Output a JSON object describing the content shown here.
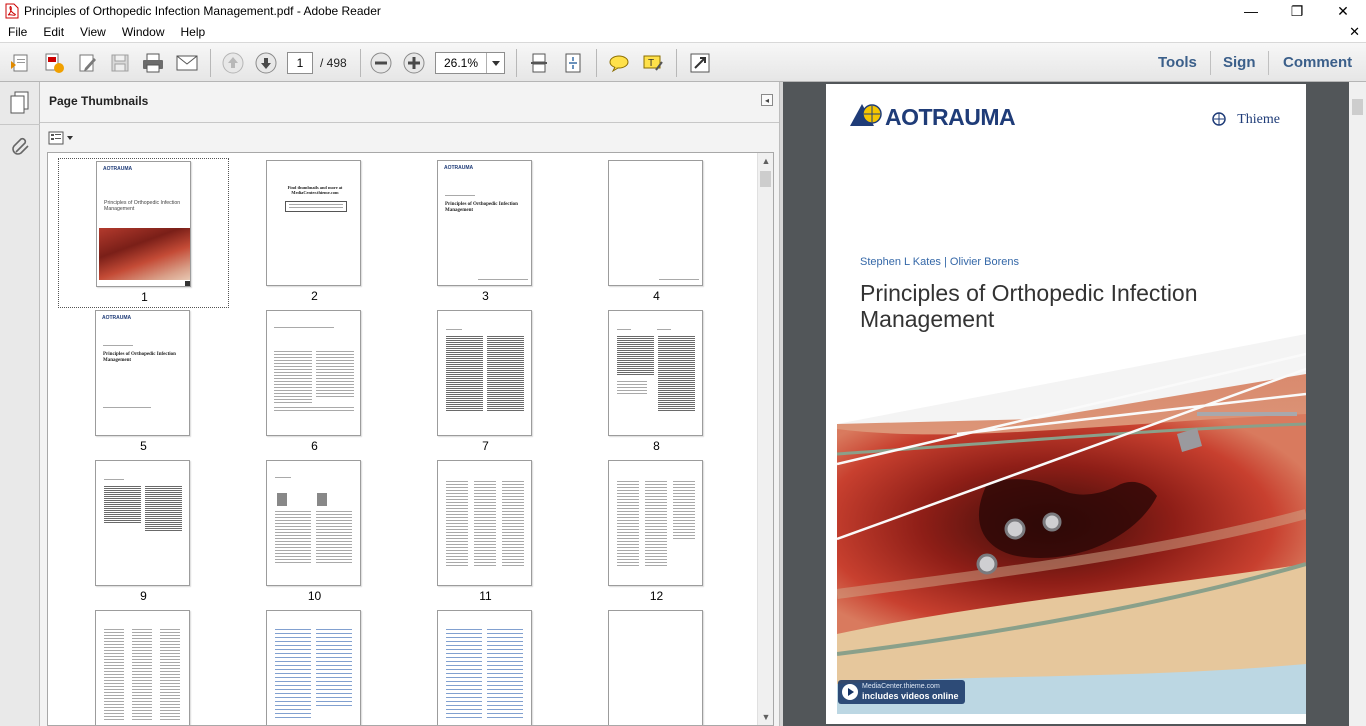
{
  "window": {
    "title": "Principles of Orthopedic Infection Management.pdf - Adobe Reader",
    "minimize": "—",
    "restore": "❐",
    "close": "✕"
  },
  "menu": {
    "items": [
      "File",
      "Edit",
      "View",
      "Window",
      "Help"
    ],
    "close_doc": "✕"
  },
  "toolbar": {
    "current_page": "1",
    "total_pages": "/ 498",
    "zoom": "26.1%",
    "links": {
      "tools": "Tools",
      "sign": "Sign",
      "comment": "Comment"
    }
  },
  "panel": {
    "title": "Page Thumbnails"
  },
  "thumbnails": {
    "p1": {
      "num": "1",
      "logo": "AOTRAUMA",
      "title": "Principles of Orthopedic Infection Management"
    },
    "p2": {
      "num": "2",
      "heading": "Find thumbnails and more at MediaCenter.thieme.com"
    },
    "p3": {
      "num": "3",
      "logo": "AOTRAUMA",
      "title": "Principles of Orthopedic Infection Management"
    },
    "p4": {
      "num": "4"
    },
    "p5": {
      "num": "5",
      "logo": "AOTRAUMA",
      "title": "Principles of Orthopedic Infection Management"
    },
    "p6": {
      "num": "6"
    },
    "p7": {
      "num": "7"
    },
    "p8": {
      "num": "8"
    },
    "p9": {
      "num": "9"
    },
    "p10": {
      "num": "10"
    },
    "p11": {
      "num": "11"
    },
    "p12": {
      "num": "12"
    }
  },
  "cover": {
    "logo": "AOTRAUMA",
    "publisher": "Thieme",
    "authors": "Stephen L Kates  |  Olivier Borens",
    "title": "Principles of Orthopedic Infection Management",
    "media_line1": "MediaCenter.thieme.com",
    "media_line2": "includes videos online"
  },
  "colors": {
    "ao_blue": "#1f3c78",
    "ao_yellow": "#f4c400",
    "link_blue": "#3b5f8a",
    "doc_background": "#525659"
  }
}
